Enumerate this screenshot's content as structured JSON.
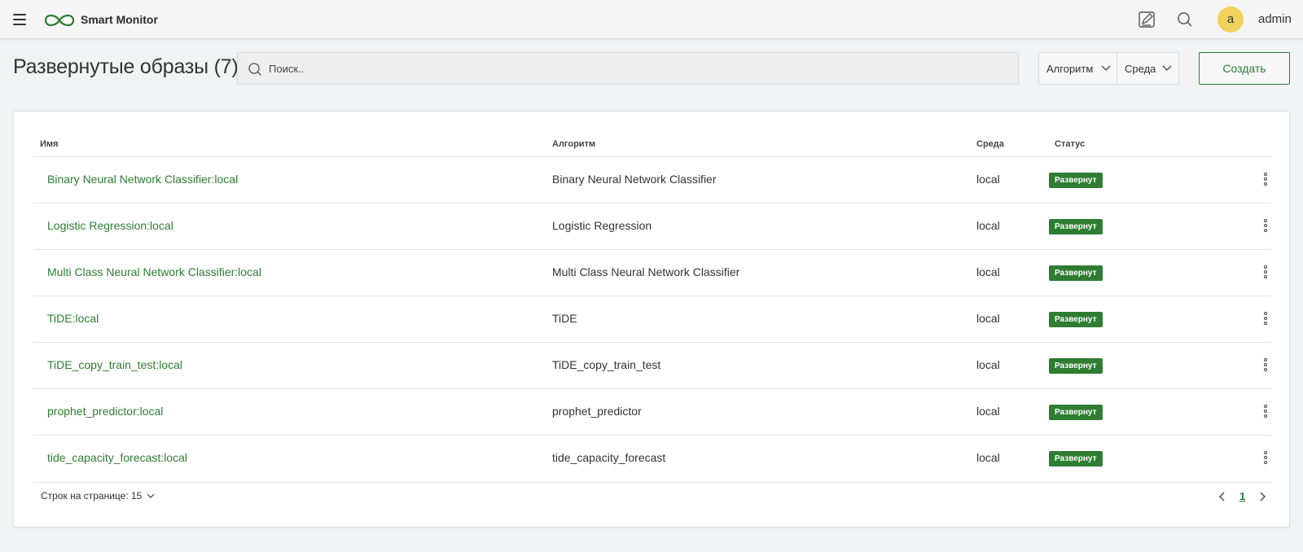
{
  "app": {
    "title": "Smart Monitor"
  },
  "user": {
    "initial": "a",
    "name": "admin"
  },
  "page": {
    "title": "Развернутые образы (7)"
  },
  "search": {
    "placeholder": "Поиск.."
  },
  "filters": {
    "algorithm": "Алгоритм",
    "environment": "Среда"
  },
  "actions": {
    "create": "Создать"
  },
  "table": {
    "columns": [
      "Имя",
      "Алгоритм",
      "Среда",
      "Статус"
    ],
    "rows": [
      {
        "name": "Binary Neural Network Classifier:local",
        "algorithm": "Binary Neural Network Classifier",
        "environment": "local",
        "status": "Развернут"
      },
      {
        "name": "Logistic Regression:local",
        "algorithm": "Logistic Regression",
        "environment": "local",
        "status": "Развернут"
      },
      {
        "name": "Multi Class Neural Network Classifier:local",
        "algorithm": "Multi Class Neural Network Classifier",
        "environment": "local",
        "status": "Развернут"
      },
      {
        "name": "TiDE:local",
        "algorithm": "TiDE",
        "environment": "local",
        "status": "Развернут"
      },
      {
        "name": "TiDE_copy_train_test:local",
        "algorithm": "TiDE_copy_train_test",
        "environment": "local",
        "status": "Развернут"
      },
      {
        "name": "prophet_predictor:local",
        "algorithm": "prophet_predictor",
        "environment": "local",
        "status": "Развернут"
      },
      {
        "name": "tide_capacity_forecast:local",
        "algorithm": "tide_capacity_forecast",
        "environment": "local",
        "status": "Развернут"
      }
    ]
  },
  "pagination": {
    "rows_per_page_label": "Строк на странице: 15",
    "current_page": "1"
  },
  "colors": {
    "accent": "#2e7d32",
    "avatar": "#f0d25c",
    "background": "#f2f3f4"
  }
}
